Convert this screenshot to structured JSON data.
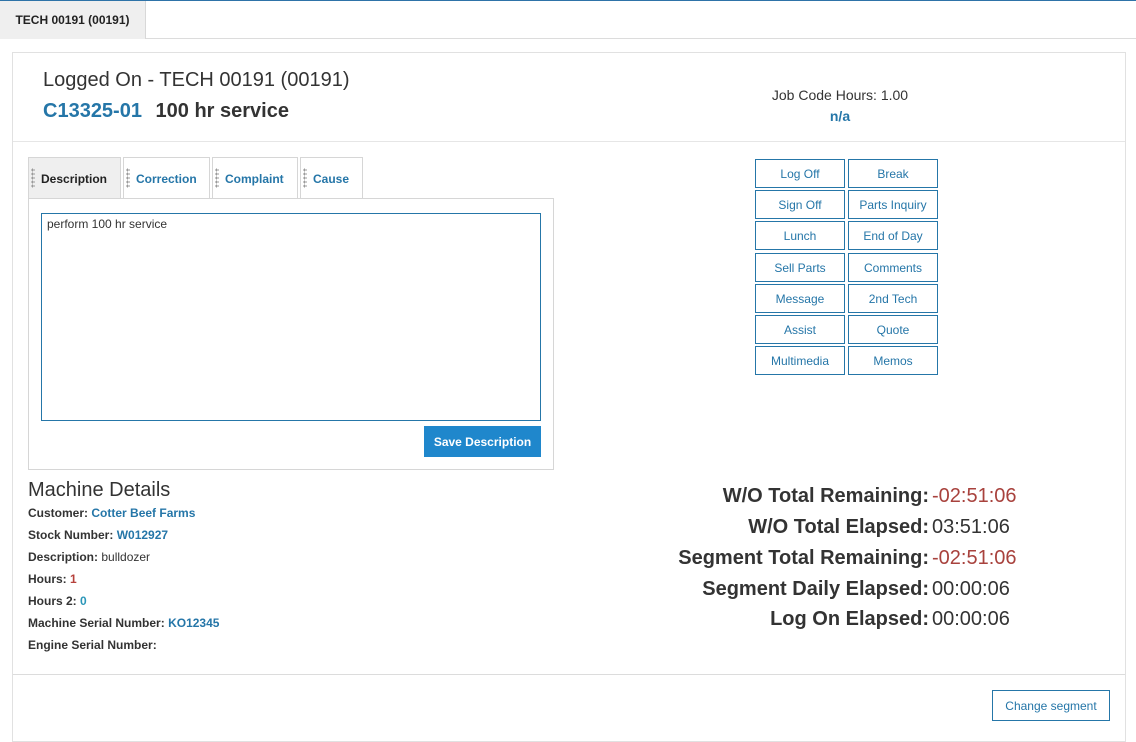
{
  "top_tab": {
    "label": "TECH 00191 (00191)"
  },
  "header": {
    "logged_on": "Logged On - TECH 00191 (00191)",
    "wo_number": "C13325-01",
    "wo_description": "100 hr service",
    "job_code_hours": "Job Code Hours: 1.00",
    "job_code_na": "n/a"
  },
  "tabs": [
    {
      "label": "Description"
    },
    {
      "label": "Correction"
    },
    {
      "label": "Complaint"
    },
    {
      "label": "Cause"
    }
  ],
  "description_text": "perform 100 hr service",
  "save_label": "Save Description",
  "actions": [
    {
      "label": "Log Off"
    },
    {
      "label": "Break"
    },
    {
      "label": "Sign Off"
    },
    {
      "label": "Parts Inquiry"
    },
    {
      "label": "Lunch"
    },
    {
      "label": "End of Day"
    },
    {
      "label": "Sell Parts"
    },
    {
      "label": "Comments"
    },
    {
      "label": "Message"
    },
    {
      "label": "2nd Tech"
    },
    {
      "label": "Assist"
    },
    {
      "label": "Quote"
    },
    {
      "label": "Multimedia"
    },
    {
      "label": "Memos"
    }
  ],
  "machine": {
    "title": "Machine Details",
    "customer_label": "Customer:",
    "customer": "Cotter Beef Farms",
    "stock_label": "Stock Number:",
    "stock": "W012927",
    "description_label": "Description:",
    "description": "bulldozer",
    "hours_label": "Hours:",
    "hours": "1",
    "hours2_label": "Hours 2:",
    "hours2": "0",
    "machine_serial_label": "Machine Serial Number:",
    "machine_serial": "KO12345",
    "engine_serial_label": "Engine Serial Number:",
    "engine_serial": ""
  },
  "timers": [
    {
      "label": "W/O Total Remaining:",
      "value": "-02:51:06",
      "negative": true
    },
    {
      "label": "W/O Total Elapsed:",
      "value": "03:51:06",
      "negative": false
    },
    {
      "label": "Segment Total Remaining:",
      "value": "-02:51:06",
      "negative": true
    },
    {
      "label": "Segment Daily Elapsed:",
      "value": "00:00:06",
      "negative": false
    },
    {
      "label": "Log On Elapsed:",
      "value": "00:00:06",
      "negative": false
    }
  ],
  "change_segment_label": "Change segment"
}
